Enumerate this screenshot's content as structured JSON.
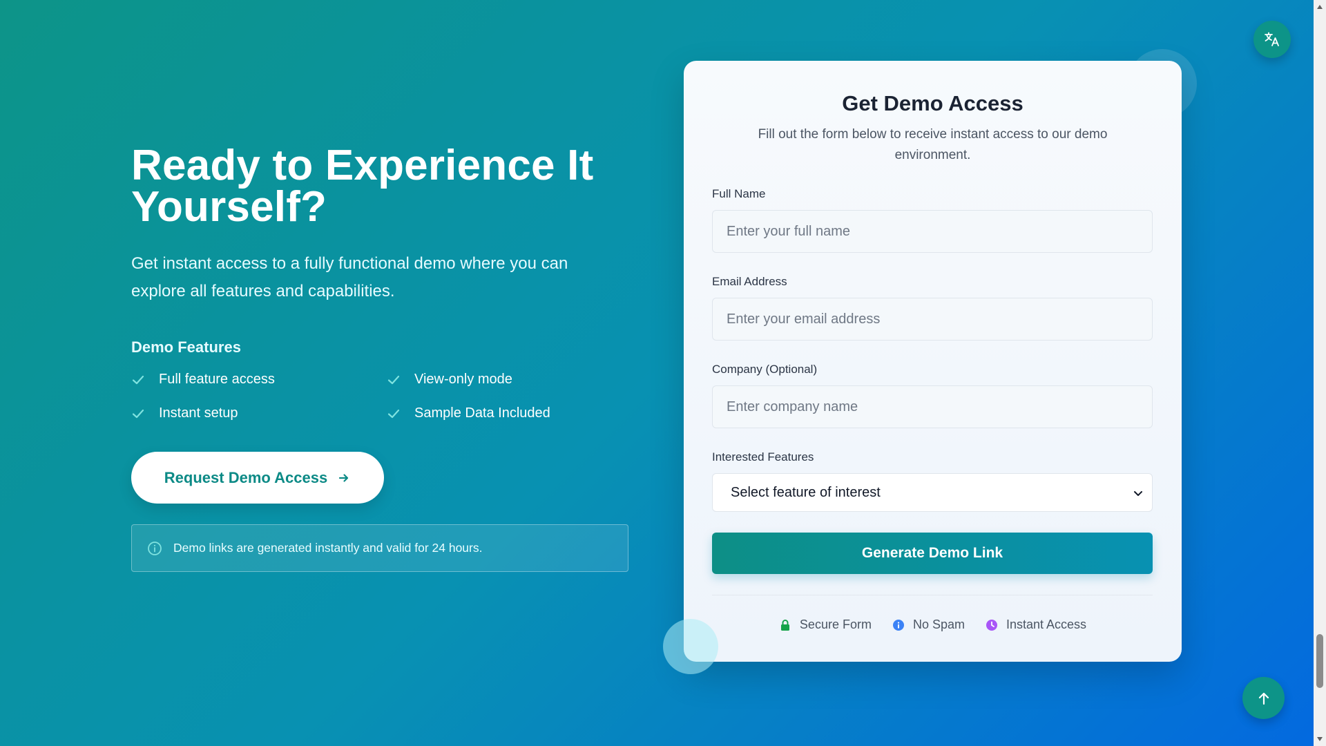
{
  "hero": {
    "title": "Ready to Experience It Yourself?",
    "subtitle": "Get instant access to a fully functional demo where you can explore all features and capabilities.",
    "features_title": "Demo Features",
    "features": [
      "Full feature access",
      "View-only mode",
      "Instant setup",
      "Sample Data Included"
    ],
    "request_button": "Request Demo Access",
    "info_text": "Demo links are generated instantly and valid for 24 hours."
  },
  "form": {
    "title": "Get Demo Access",
    "subtitle": "Fill out the form below to receive instant access to our demo environment.",
    "full_name": {
      "label": "Full Name",
      "placeholder": "Enter your full name"
    },
    "email": {
      "label": "Email Address",
      "placeholder": "Enter your email address"
    },
    "company": {
      "label": "Company (Optional)",
      "placeholder": "Enter company name"
    },
    "features": {
      "label": "Interested Features",
      "selected": "Select feature of interest"
    },
    "submit_button": "Generate Demo Link",
    "badges": [
      {
        "label": "Secure Form",
        "icon": "lock-icon",
        "color": "#16a34a"
      },
      {
        "label": "No Spam",
        "icon": "info-icon",
        "color": "#3b82f6"
      },
      {
        "label": "Instant Access",
        "icon": "clock-icon",
        "color": "#a855f7"
      }
    ]
  },
  "colors": {
    "accent": "#0d9488",
    "gradient_start": "#0d9488",
    "gradient_end": "#0369e0"
  }
}
